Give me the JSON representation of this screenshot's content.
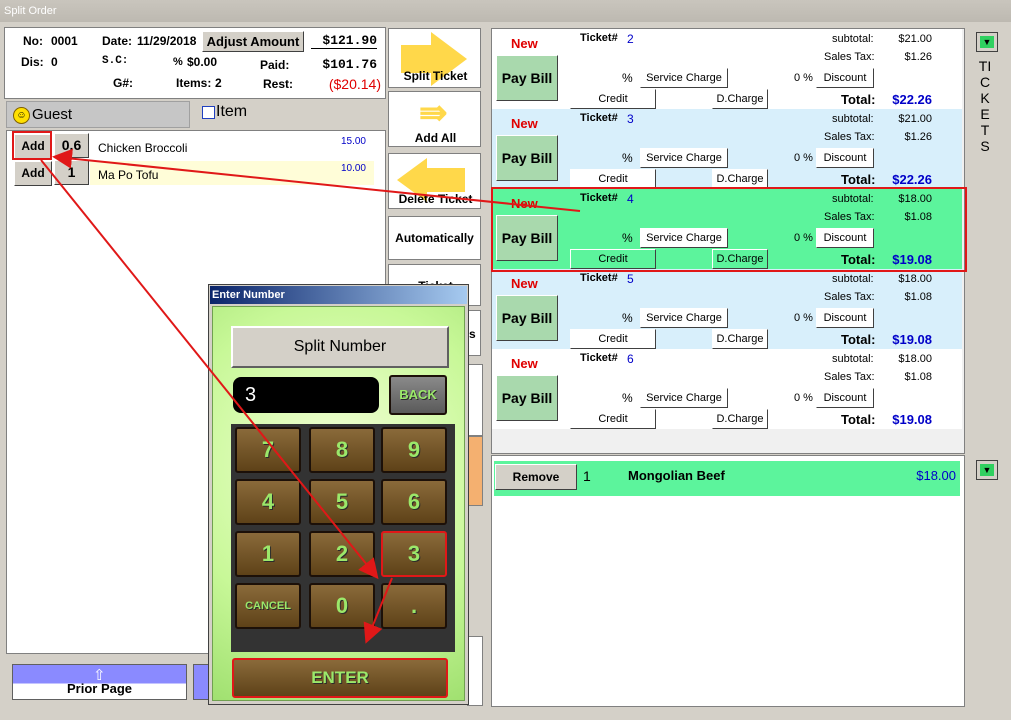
{
  "window": {
    "title": "Split Order"
  },
  "order": {
    "no_label": "No:",
    "no": "0001",
    "date_label": "Date:",
    "date": "11/29/2018",
    "adjust_label": "Adjust Amount",
    "total": "$121.90",
    "dis_label": "Dis:",
    "dis": "0",
    "sc_label": "S.C:",
    "sc_pct": "%",
    "sc_amount": "$0.00",
    "paid_label": "Paid:",
    "paid": "$101.76",
    "g_label": "G#:",
    "items_label": "Items:",
    "items": "2",
    "rest_label": "Rest:",
    "rest": "($20.14)"
  },
  "tabs": {
    "guest": "Guest",
    "item": "Item"
  },
  "items": [
    {
      "add": "Add",
      "qty": "0.6",
      "name": "Chicken Broccoli",
      "price": "15.00"
    },
    {
      "add": "Add",
      "qty": "1",
      "name": "Ma Po Tofu",
      "price": "10.00"
    }
  ],
  "nav": {
    "prior_page": "Prior Page"
  },
  "side_buttons": {
    "split_ticket": "Split Ticket",
    "add_all": "Add All",
    "delete_ticket": "Delete Ticket",
    "automatically": "Automatically",
    "ticket": "Ticket",
    "s_fragment": "s"
  },
  "tickets": [
    {
      "status": "New",
      "label": "Ticket#",
      "num": "2",
      "subtotal_label": "subtotal:",
      "subtotal": "$21.00",
      "tax_label": "Sales Tax:",
      "tax": "$1.26",
      "pay": "Pay Bill",
      "pct": "%",
      "service": "Service Charge",
      "disc_pct": "0 %",
      "discount": "Discount",
      "credit": "Credit",
      "dcharge": "D.Charge",
      "total_label": "Total:",
      "total": "$22.26"
    },
    {
      "status": "New",
      "label": "Ticket#",
      "num": "3",
      "subtotal_label": "subtotal:",
      "subtotal": "$21.00",
      "tax_label": "Sales Tax:",
      "tax": "$1.26",
      "pay": "Pay Bill",
      "pct": "%",
      "service": "Service Charge",
      "disc_pct": "0 %",
      "discount": "Discount",
      "credit": "Credit",
      "dcharge": "D.Charge",
      "total_label": "Total:",
      "total": "$22.26"
    },
    {
      "status": "New",
      "label": "Ticket#",
      "num": "4",
      "subtotal_label": "subtotal:",
      "subtotal": "$18.00",
      "tax_label": "Sales Tax:",
      "tax": "$1.08",
      "pay": "Pay Bill",
      "pct": "%",
      "service": "Service Charge",
      "disc_pct": "0 %",
      "discount": "Discount",
      "credit": "Credit",
      "dcharge": "D.Charge",
      "total_label": "Total:",
      "total": "$19.08"
    },
    {
      "status": "New",
      "label": "Ticket#",
      "num": "5",
      "subtotal_label": "subtotal:",
      "subtotal": "$18.00",
      "tax_label": "Sales Tax:",
      "tax": "$1.08",
      "pay": "Pay Bill",
      "pct": "%",
      "service": "Service Charge",
      "disc_pct": "0 %",
      "discount": "Discount",
      "credit": "Credit",
      "dcharge": "D.Charge",
      "total_label": "Total:",
      "total": "$19.08"
    },
    {
      "status": "New",
      "label": "Ticket#",
      "num": "6",
      "subtotal_label": "subtotal:",
      "subtotal": "$18.00",
      "tax_label": "Sales Tax:",
      "tax": "$1.08",
      "pay": "Pay Bill",
      "pct": "%",
      "service": "Service Charge",
      "disc_pct": "0 %",
      "discount": "Discount",
      "credit": "Credit",
      "dcharge": "D.Charge",
      "total_label": "Total:",
      "total": "$19.08"
    }
  ],
  "ticket_items": [
    {
      "remove": "Remove",
      "qty": "1",
      "name": "Mongolian Beef",
      "price": "$18.00"
    }
  ],
  "tickets_side_label": "TICKETS",
  "dialog": {
    "title": "Enter Number",
    "heading": "Split Number",
    "value": "3",
    "back": "BACK",
    "keys": [
      "7",
      "8",
      "9",
      "4",
      "5",
      "6",
      "1",
      "2",
      "3",
      "CANCEL",
      "0",
      "."
    ],
    "enter": "ENTER"
  },
  "colors": {
    "accent_red": "#e00000",
    "ticket_green": "#5cf49c",
    "ticket_blue": "#d8effb"
  }
}
